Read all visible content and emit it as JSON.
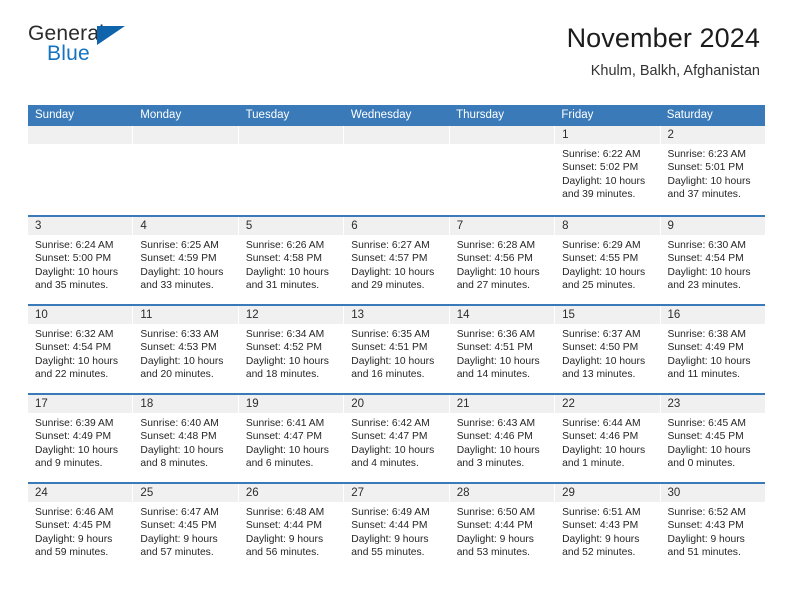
{
  "brand": {
    "word_one": "General",
    "word_two": "Blue",
    "triangle_color": "#1064ab",
    "blue_text_color": "#1673c0"
  },
  "header": {
    "title": "November 2024",
    "location": "Khulm, Balkh, Afghanistan",
    "accent_color": "#3a7ab8",
    "daynum_bg": "#f0f0f0"
  },
  "weekdays": [
    "Sunday",
    "Monday",
    "Tuesday",
    "Wednesday",
    "Thursday",
    "Friday",
    "Saturday"
  ],
  "labels": {
    "sunrise_prefix": "Sunrise:",
    "sunset_prefix": "Sunset:",
    "daylight_prefix": "Daylight:"
  },
  "weeks": [
    [
      {
        "day": "",
        "empty": true
      },
      {
        "day": "",
        "empty": true
      },
      {
        "day": "",
        "empty": true
      },
      {
        "day": "",
        "empty": true
      },
      {
        "day": "",
        "empty": true
      },
      {
        "day": "1",
        "sunrise": "Sunrise: 6:22 AM",
        "sunset": "Sunset: 5:02 PM",
        "daylight_line1": "Daylight: 10 hours",
        "daylight_line2": "and 39 minutes."
      },
      {
        "day": "2",
        "sunrise": "Sunrise: 6:23 AM",
        "sunset": "Sunset: 5:01 PM",
        "daylight_line1": "Daylight: 10 hours",
        "daylight_line2": "and 37 minutes."
      }
    ],
    [
      {
        "day": "3",
        "sunrise": "Sunrise: 6:24 AM",
        "sunset": "Sunset: 5:00 PM",
        "daylight_line1": "Daylight: 10 hours",
        "daylight_line2": "and 35 minutes."
      },
      {
        "day": "4",
        "sunrise": "Sunrise: 6:25 AM",
        "sunset": "Sunset: 4:59 PM",
        "daylight_line1": "Daylight: 10 hours",
        "daylight_line2": "and 33 minutes."
      },
      {
        "day": "5",
        "sunrise": "Sunrise: 6:26 AM",
        "sunset": "Sunset: 4:58 PM",
        "daylight_line1": "Daylight: 10 hours",
        "daylight_line2": "and 31 minutes."
      },
      {
        "day": "6",
        "sunrise": "Sunrise: 6:27 AM",
        "sunset": "Sunset: 4:57 PM",
        "daylight_line1": "Daylight: 10 hours",
        "daylight_line2": "and 29 minutes."
      },
      {
        "day": "7",
        "sunrise": "Sunrise: 6:28 AM",
        "sunset": "Sunset: 4:56 PM",
        "daylight_line1": "Daylight: 10 hours",
        "daylight_line2": "and 27 minutes."
      },
      {
        "day": "8",
        "sunrise": "Sunrise: 6:29 AM",
        "sunset": "Sunset: 4:55 PM",
        "daylight_line1": "Daylight: 10 hours",
        "daylight_line2": "and 25 minutes."
      },
      {
        "day": "9",
        "sunrise": "Sunrise: 6:30 AM",
        "sunset": "Sunset: 4:54 PM",
        "daylight_line1": "Daylight: 10 hours",
        "daylight_line2": "and 23 minutes."
      }
    ],
    [
      {
        "day": "10",
        "sunrise": "Sunrise: 6:32 AM",
        "sunset": "Sunset: 4:54 PM",
        "daylight_line1": "Daylight: 10 hours",
        "daylight_line2": "and 22 minutes."
      },
      {
        "day": "11",
        "sunrise": "Sunrise: 6:33 AM",
        "sunset": "Sunset: 4:53 PM",
        "daylight_line1": "Daylight: 10 hours",
        "daylight_line2": "and 20 minutes."
      },
      {
        "day": "12",
        "sunrise": "Sunrise: 6:34 AM",
        "sunset": "Sunset: 4:52 PM",
        "daylight_line1": "Daylight: 10 hours",
        "daylight_line2": "and 18 minutes."
      },
      {
        "day": "13",
        "sunrise": "Sunrise: 6:35 AM",
        "sunset": "Sunset: 4:51 PM",
        "daylight_line1": "Daylight: 10 hours",
        "daylight_line2": "and 16 minutes."
      },
      {
        "day": "14",
        "sunrise": "Sunrise: 6:36 AM",
        "sunset": "Sunset: 4:51 PM",
        "daylight_line1": "Daylight: 10 hours",
        "daylight_line2": "and 14 minutes."
      },
      {
        "day": "15",
        "sunrise": "Sunrise: 6:37 AM",
        "sunset": "Sunset: 4:50 PM",
        "daylight_line1": "Daylight: 10 hours",
        "daylight_line2": "and 13 minutes."
      },
      {
        "day": "16",
        "sunrise": "Sunrise: 6:38 AM",
        "sunset": "Sunset: 4:49 PM",
        "daylight_line1": "Daylight: 10 hours",
        "daylight_line2": "and 11 minutes."
      }
    ],
    [
      {
        "day": "17",
        "sunrise": "Sunrise: 6:39 AM",
        "sunset": "Sunset: 4:49 PM",
        "daylight_line1": "Daylight: 10 hours",
        "daylight_line2": "and 9 minutes."
      },
      {
        "day": "18",
        "sunrise": "Sunrise: 6:40 AM",
        "sunset": "Sunset: 4:48 PM",
        "daylight_line1": "Daylight: 10 hours",
        "daylight_line2": "and 8 minutes."
      },
      {
        "day": "19",
        "sunrise": "Sunrise: 6:41 AM",
        "sunset": "Sunset: 4:47 PM",
        "daylight_line1": "Daylight: 10 hours",
        "daylight_line2": "and 6 minutes."
      },
      {
        "day": "20",
        "sunrise": "Sunrise: 6:42 AM",
        "sunset": "Sunset: 4:47 PM",
        "daylight_line1": "Daylight: 10 hours",
        "daylight_line2": "and 4 minutes."
      },
      {
        "day": "21",
        "sunrise": "Sunrise: 6:43 AM",
        "sunset": "Sunset: 4:46 PM",
        "daylight_line1": "Daylight: 10 hours",
        "daylight_line2": "and 3 minutes."
      },
      {
        "day": "22",
        "sunrise": "Sunrise: 6:44 AM",
        "sunset": "Sunset: 4:46 PM",
        "daylight_line1": "Daylight: 10 hours",
        "daylight_line2": "and 1 minute."
      },
      {
        "day": "23",
        "sunrise": "Sunrise: 6:45 AM",
        "sunset": "Sunset: 4:45 PM",
        "daylight_line1": "Daylight: 10 hours",
        "daylight_line2": "and 0 minutes."
      }
    ],
    [
      {
        "day": "24",
        "sunrise": "Sunrise: 6:46 AM",
        "sunset": "Sunset: 4:45 PM",
        "daylight_line1": "Daylight: 9 hours",
        "daylight_line2": "and 59 minutes."
      },
      {
        "day": "25",
        "sunrise": "Sunrise: 6:47 AM",
        "sunset": "Sunset: 4:45 PM",
        "daylight_line1": "Daylight: 9 hours",
        "daylight_line2": "and 57 minutes."
      },
      {
        "day": "26",
        "sunrise": "Sunrise: 6:48 AM",
        "sunset": "Sunset: 4:44 PM",
        "daylight_line1": "Daylight: 9 hours",
        "daylight_line2": "and 56 minutes."
      },
      {
        "day": "27",
        "sunrise": "Sunrise: 6:49 AM",
        "sunset": "Sunset: 4:44 PM",
        "daylight_line1": "Daylight: 9 hours",
        "daylight_line2": "and 55 minutes."
      },
      {
        "day": "28",
        "sunrise": "Sunrise: 6:50 AM",
        "sunset": "Sunset: 4:44 PM",
        "daylight_line1": "Daylight: 9 hours",
        "daylight_line2": "and 53 minutes."
      },
      {
        "day": "29",
        "sunrise": "Sunrise: 6:51 AM",
        "sunset": "Sunset: 4:43 PM",
        "daylight_line1": "Daylight: 9 hours",
        "daylight_line2": "and 52 minutes."
      },
      {
        "day": "30",
        "sunrise": "Sunrise: 6:52 AM",
        "sunset": "Sunset: 4:43 PM",
        "daylight_line1": "Daylight: 9 hours",
        "daylight_line2": "and 51 minutes."
      }
    ]
  ]
}
